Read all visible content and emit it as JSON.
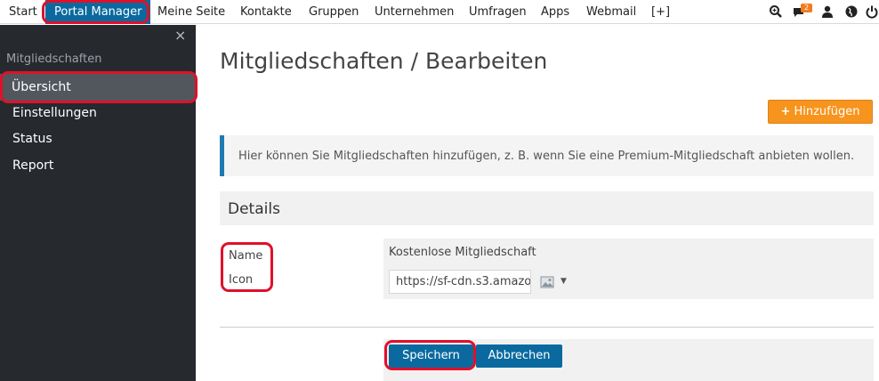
{
  "topnav": {
    "items": [
      "Start",
      "Portal Manager",
      "Meine Seite",
      "Kontakte",
      "Gruppen",
      "Unternehmen",
      "Umfragen",
      "Apps",
      "Webmail",
      "[+]"
    ],
    "active_index": 1,
    "notification_count": "2",
    "icons": [
      "zoom-search-icon",
      "chat-bubble-icon",
      "user-icon",
      "globe-icon",
      "power-icon"
    ]
  },
  "sidebar": {
    "close": "×",
    "heading": "Mitgliedschaften",
    "items": [
      "Übersicht",
      "Einstellungen",
      "Status",
      "Report"
    ],
    "active_index": 0
  },
  "main": {
    "title": "Mitgliedschaften / Bearbeiten",
    "add_button": "Hinzufügen",
    "add_plus": "+",
    "info_text": "Hier können Sie Mitgliedschaften hinzufügen, z. B. wenn Sie eine Premium-Mitgliedschaft anbieten wollen.",
    "details_heading": "Details",
    "fields": {
      "name_label": "Name",
      "name_value": "Kostenlose Mitgliedschaft",
      "icon_label": "Icon",
      "icon_value": "https://sf-cdn.s3.amazo"
    },
    "save_button": "Speichern",
    "cancel_button": "Abbrechen"
  },
  "colors": {
    "accent_blue": "#0a6aa0",
    "add_orange": "#f7941d",
    "sidebar_bg": "#26292e",
    "highlight_red": "#e0102a"
  }
}
